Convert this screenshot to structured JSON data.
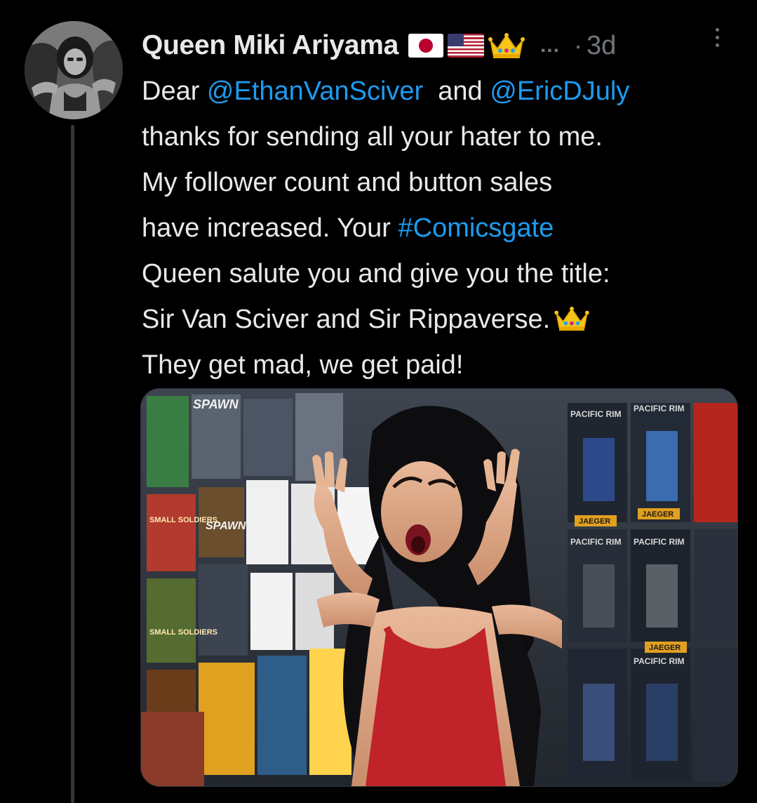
{
  "author": {
    "display_name": "Queen Miki Ariyama",
    "badges": [
      "flag-japan-emoji",
      "flag-usa-emoji",
      "crown-emoji"
    ],
    "truncation": "...",
    "separator": "·",
    "timestamp": "3d"
  },
  "tweet": {
    "lines": [
      {
        "before": "Dear ",
        "mention1": "@EthanVanSciver",
        "middle": "  and ",
        "mention2": "@EricDJuly"
      },
      {
        "text": "thanks for sending all your hater to me."
      },
      {
        "text": "My follower count and button sales"
      },
      {
        "before": "have increased. Your ",
        "hashtag": "#Comicsgate"
      },
      {
        "text": "Queen salute you and give you the title:"
      },
      {
        "text": "Sir Van Sciver and Sir Rippaverse."
      },
      {
        "text": "They get mad, we get paid!"
      }
    ]
  },
  "media": {
    "box_labels": {
      "spawn_top": "SPAWN",
      "spawn_mid": "SPAWN",
      "small_soldiers_1": "SMALL SOLDIERS",
      "small_soldiers_2": "SMALL SOLDIERS",
      "pacific_rim_1": "PACIFIC RIM",
      "pacific_rim_2": "PACIFIC RIM",
      "pacific_rim_3": "PACIFIC RIM",
      "pacific_rim_4": "PACIFIC RIM",
      "pacific_rim_5": "PACIFIC RIM",
      "jaeger_1": "JAEGER",
      "jaeger_2": "JAEGER",
      "jaeger_3": "JAEGER"
    }
  },
  "colors": {
    "background": "#000000",
    "text_primary": "#e7e9ea",
    "text_secondary": "#71767b",
    "link": "#1d9bf0",
    "thread_line": "#333639"
  },
  "icons": {
    "more": "more-vertical-icon"
  }
}
